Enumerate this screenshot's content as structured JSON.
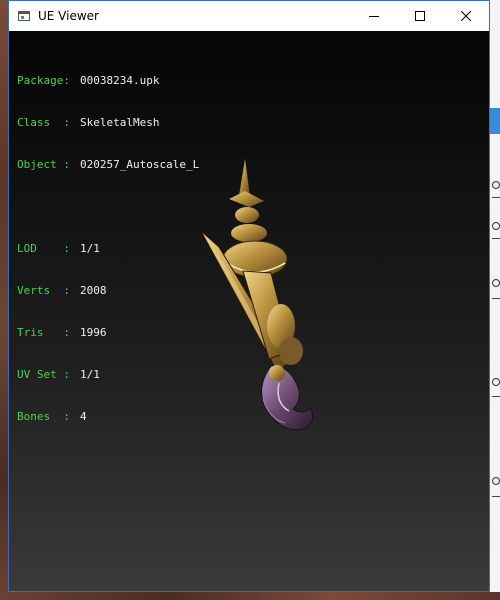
{
  "window": {
    "title": "UE Viewer",
    "controls": [
      "minimize",
      "maximize",
      "close"
    ]
  },
  "info": {
    "object_rows": [
      {
        "label": "Package",
        "value": "00038234.upk"
      },
      {
        "label": "Class  ",
        "value": "SkeletalMesh"
      },
      {
        "label": "Object ",
        "value": "020257_Autoscale_L"
      }
    ],
    "mesh_rows": [
      {
        "label": "LOD    ",
        "value": "1/1"
      },
      {
        "label": "Verts  ",
        "value": "2008"
      },
      {
        "label": "Tris   ",
        "value": "1996"
      },
      {
        "label": "UV Set ",
        "value": "1/1"
      },
      {
        "label": "Bones  ",
        "value": "4"
      }
    ]
  },
  "colors": {
    "label": "#4cd24c",
    "value": "#f0f0f0",
    "viewport_top": "#050505",
    "viewport_bottom": "#3a3a3a",
    "model_gold": "#c9a24a"
  },
  "icons": {
    "app": "window-app-icon",
    "minimize": "minimize-icon",
    "maximize": "maximize-icon",
    "close": "close-icon"
  }
}
